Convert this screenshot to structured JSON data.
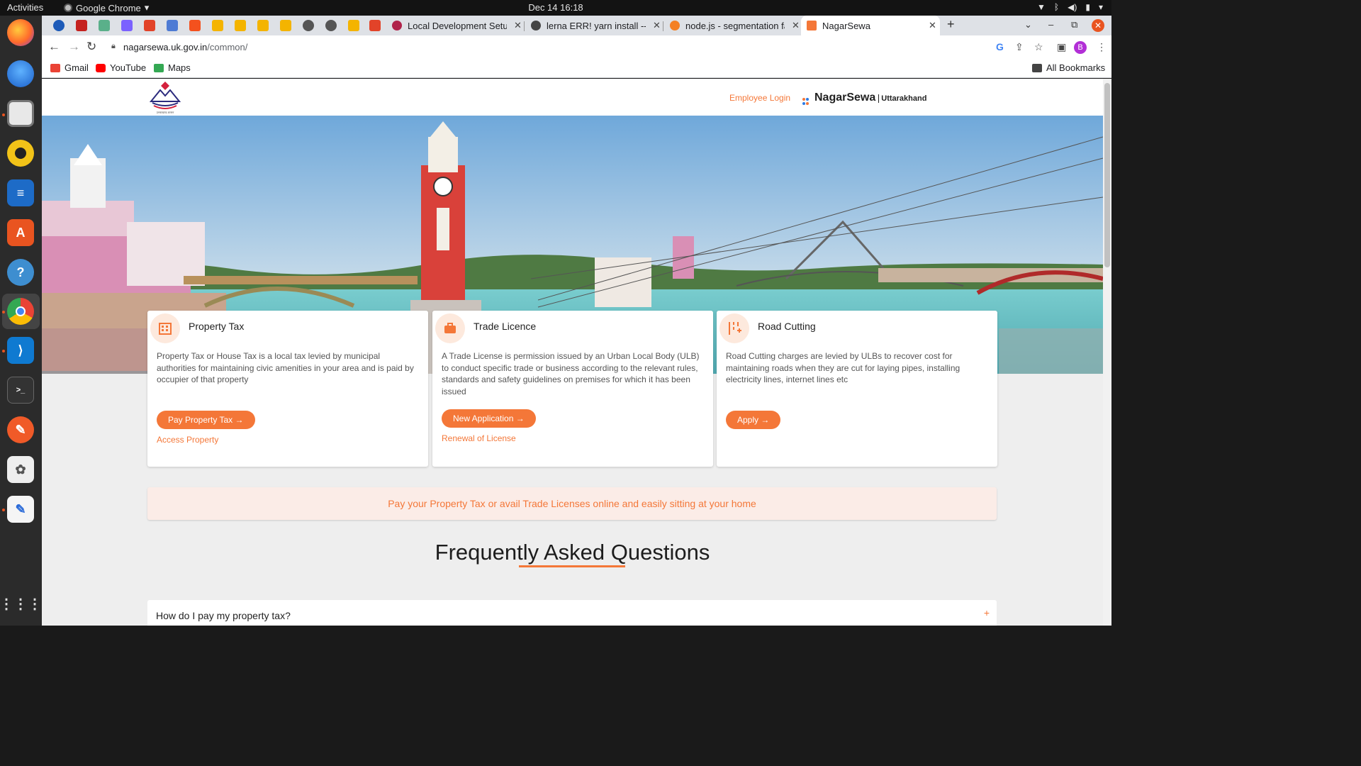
{
  "os": {
    "activities": "Activities",
    "app_name": "Google Chrome",
    "clock": "Dec 14  16:18",
    "dock_items": [
      "firefox-icon",
      "thunderbird-icon",
      "files-icon",
      "rhythmbox-icon",
      "writer-icon",
      "app-center-icon",
      "help-icon",
      "chrome-icon",
      "vscode-icon",
      "terminal-icon",
      "pen-tool-icon",
      "gimp-icon",
      "text-editor-icon",
      "show-apps-icon"
    ]
  },
  "browser": {
    "tabs": [
      {
        "title": "Local Development Setup",
        "active": false
      },
      {
        "title": "lerna ERR! yarn install --mutex",
        "active": false
      },
      {
        "title": "node.js - segmentation fault",
        "active": false
      },
      {
        "title": "NagarSewa",
        "active": true
      }
    ],
    "new_tab": "+",
    "url_host": "nagarsewa.uk.gov.in",
    "url_path": "/common/",
    "bookmarks": [
      {
        "label": "Gmail",
        "color": "#ea4335"
      },
      {
        "label": "YouTube",
        "color": "#ff0000"
      },
      {
        "label": "Maps",
        "color": "#34a853"
      }
    ],
    "all_bookmarks": "All Bookmarks",
    "profile_initial": "B"
  },
  "site": {
    "emblem_caption": "उत्तराखण्ड शासन",
    "employee_login": "Employee Login",
    "brand_name": "NagarSewa",
    "brand_state": "Uttarakhand",
    "accent_color": "#f47738",
    "cards": [
      {
        "title": "Property Tax",
        "description": "Property Tax or House Tax is a local tax levied by municipal authorities for maintaining civic amenities in your area and is paid by occupier of that property",
        "cta": "Pay Property Tax →",
        "link": "Access Property"
      },
      {
        "title": "Trade Licence",
        "description": "A Trade License is permission issued by an Urban Local Body (ULB) to conduct specific trade or business according to the relevant rules, standards and safety guidelines on premises for which it has been issued",
        "cta": "New Application →",
        "link": "Renewal of License"
      },
      {
        "title": "Road Cutting",
        "description": "Road Cutting charges are levied by ULBs to recover cost for maintaining roads when they are cut for laying pipes, installing electricity lines, internet lines etc",
        "cta": "Apply →",
        "link": ""
      }
    ],
    "info_banner": "Pay your Property Tax or avail Trade Licenses online and easily sitting at your home",
    "faq_title": "Frequently Asked Questions",
    "faq_items": [
      {
        "question": "How do I pay my property tax?",
        "toggle": "+"
      }
    ]
  }
}
